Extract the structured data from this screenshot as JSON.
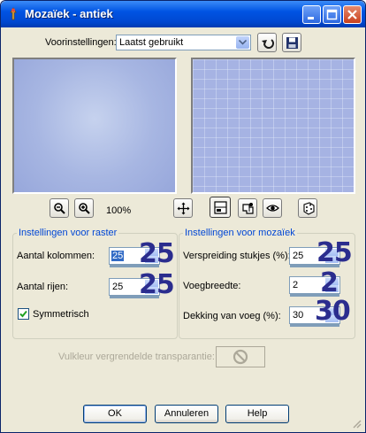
{
  "window": {
    "title": "Mozaïek - antiek"
  },
  "presets": {
    "label": "Voorinstellingen:",
    "value": "Laatst gebruikt"
  },
  "zoom": {
    "level": "100%"
  },
  "raster": {
    "legend": "Instellingen voor raster",
    "columns": {
      "label": "Aantal kolommen:",
      "value": "25",
      "callout": "25"
    },
    "rows": {
      "label": "Aantal rijen:",
      "value": "25",
      "callout": "25"
    },
    "symmetric": {
      "label": "Symmetrisch",
      "checked": true
    }
  },
  "mosaic": {
    "legend": "Instellingen voor mozaïek",
    "spread": {
      "label": "Verspreiding stukjes (%):",
      "value": "25",
      "callout": "25"
    },
    "grout_width": {
      "label": "Voegbreedte:",
      "value": "2",
      "callout": "2"
    },
    "grout_coverage": {
      "label": "Dekking van voeg (%):",
      "value": "30",
      "callout": "30"
    }
  },
  "transparency": {
    "label": "Vulkleur vergrendelde transparantie:"
  },
  "buttons": {
    "ok": "OK",
    "cancel": "Annuleren",
    "help": "Help"
  },
  "colors": {
    "accent": "#0054e3",
    "legend": "#0046d5",
    "callout": "#2b2d8e"
  }
}
